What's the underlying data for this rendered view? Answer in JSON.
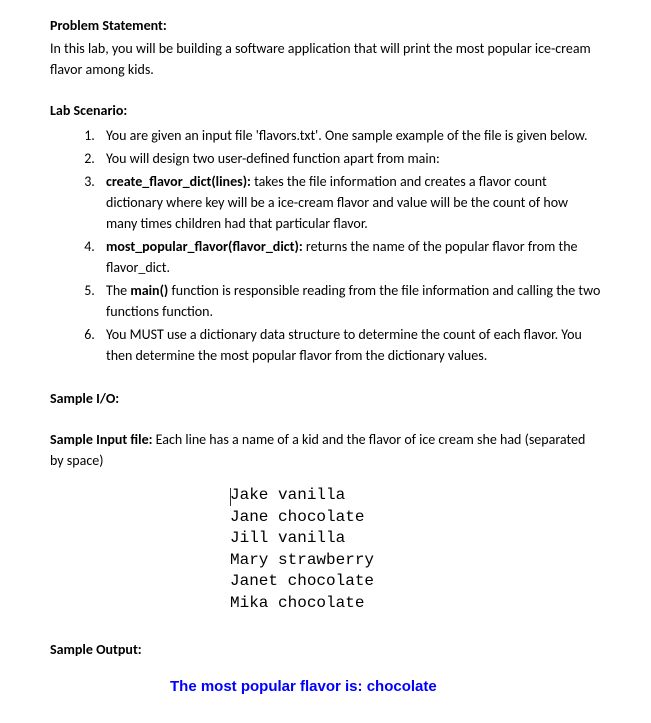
{
  "problem": {
    "heading": "Problem Statement:",
    "intro": "In this lab, you will be building a software application that will print the most popular ice-cream flavor among kids."
  },
  "scenario": {
    "heading": "Lab Scenario:",
    "items": [
      {
        "pre": "",
        "bold": "",
        "post": "You are given an input file 'flavors.txt'. One sample example of the file is given below."
      },
      {
        "pre": "",
        "bold": "",
        "post": "You will design two user-defined function apart from main:"
      },
      {
        "pre": "",
        "bold": "create_flavor_dict(lines):",
        "post": " takes the file information and creates a flavor count dictionary where key will be a ice-cream flavor and value will be the count of how many times children had that particular flavor."
      },
      {
        "pre": "",
        "bold": "most_popular_flavor(flavor_dict):",
        "post": " returns the name of the popular flavor from the flavor_dict."
      },
      {
        "pre": "The ",
        "bold": "main()",
        "post": " function is responsible reading from the file information and calling the two functions function."
      },
      {
        "pre": "",
        "bold": "",
        "post": "You MUST use a dictionary data structure to determine the count of each flavor. You then determine the most popular flavor from the dictionary values."
      }
    ]
  },
  "sample_io": {
    "heading": "Sample I/O:",
    "input_label": "Sample Input file:",
    "input_desc": " Each line has a name of a kid and the flavor of ice cream she had (separated by space)",
    "data_lines": [
      "Jake vanilla",
      "Jane chocolate",
      "Jill vanilla",
      "Mary strawberry",
      "Janet chocolate",
      "Mika chocolate"
    ],
    "output_label": "Sample Output:",
    "output_text": "The most popular flavor is:  chocolate"
  }
}
